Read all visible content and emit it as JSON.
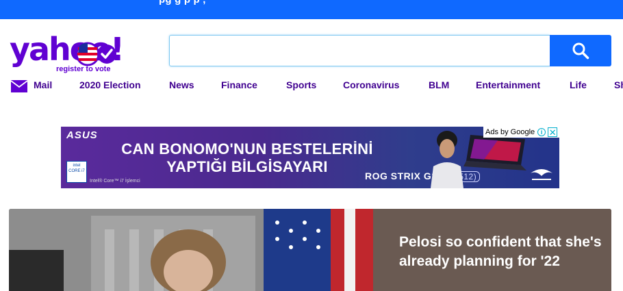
{
  "topbar": {
    "text": "pg                       g     p  p          ,",
    "color": "#0f69ff"
  },
  "logo": {
    "word": "yahoo!",
    "tagline": "register to vote",
    "brand_color": "#6001d2"
  },
  "search": {
    "value": "",
    "placeholder": "",
    "button_icon": "search-icon",
    "button_color": "#0f69ff"
  },
  "nav": {
    "items": [
      {
        "label": "Mail",
        "icon": "mail-icon"
      },
      {
        "label": "2020 Election"
      },
      {
        "label": "News"
      },
      {
        "label": "Finance"
      },
      {
        "label": "Sports"
      },
      {
        "label": "Coronavirus"
      },
      {
        "label": "BLM"
      },
      {
        "label": "Entertainment"
      },
      {
        "label": "Life"
      },
      {
        "label": "Sh"
      }
    ]
  },
  "ad": {
    "brand": "ASUS",
    "headline_line1": "CAN BONOMO'NUN BESTELERİNİ",
    "headline_line2": "YAPTIĞI BİLGİSAYARI",
    "chip_text": "intel CORE i7",
    "intel_caption": "Intel® Core™ i7 İşlemci",
    "product": "ROG STRIX G15",
    "model": "(G512)",
    "adchoices_label": "Ads by Google",
    "adchoices_info": "i",
    "adchoices_close": "✕"
  },
  "hero": {
    "headline": "Pelosi so confident that she's already planning for '22"
  }
}
